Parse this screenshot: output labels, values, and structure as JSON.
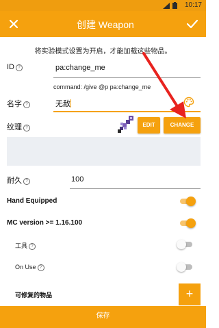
{
  "status_bar": {
    "time": "10:17",
    "icons": [
      "signal-icon",
      "battery-icon"
    ]
  },
  "app_bar": {
    "title": "创建 Weapon",
    "close_icon": "close-icon",
    "confirm_icon": "check-icon"
  },
  "notice": "将实验模式设置为开启，才能加载这些物品。",
  "fields": {
    "id": {
      "label": "ID",
      "value": "pa:change_me"
    },
    "command": "command: /give @p pa:change_me",
    "name": {
      "label": "名字",
      "value": "无敌"
    },
    "texture": {
      "label": "纹理",
      "edit_label": "EDIT",
      "change_label": "CHANGE"
    },
    "durability": {
      "label": "耐久",
      "value": "100"
    }
  },
  "toggles": [
    {
      "label": "Hand Equipped",
      "on": true
    },
    {
      "label": "MC version >= 1.16.100",
      "on": true
    },
    {
      "label": "工具",
      "on": false
    },
    {
      "label": "On Use",
      "on": false
    }
  ],
  "repairable_label": "可修复的物品",
  "add_button": "+",
  "save_label": "保存",
  "colors": {
    "primary": "#f5a10e",
    "status": "#ef9d0f",
    "arrow": "#e8231f"
  }
}
